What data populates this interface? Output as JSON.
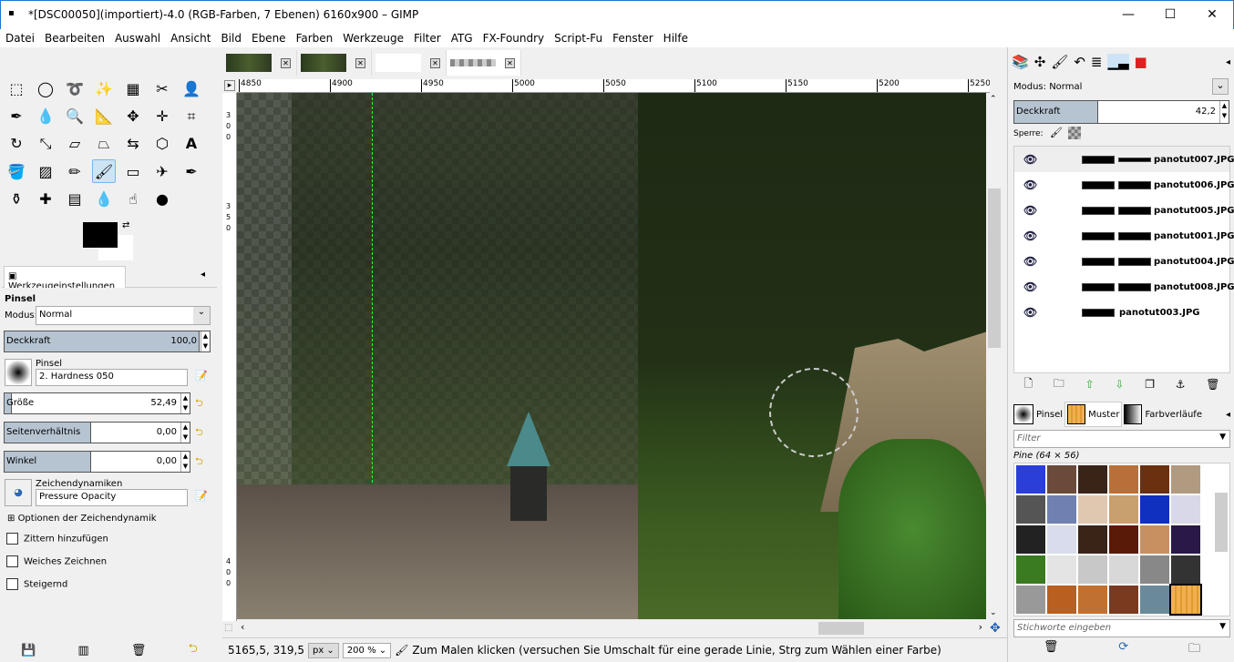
{
  "window": {
    "title": "*[DSC00050](importiert)-4.0 (RGB-Farben, 7 Ebenen) 6160x900 – GIMP",
    "minimize": "—",
    "maximize": "☐",
    "close": "✕"
  },
  "menu": [
    "Datei",
    "Bearbeiten",
    "Auswahl",
    "Ansicht",
    "Bild",
    "Ebene",
    "Farben",
    "Werkzeuge",
    "Filter",
    "ATG",
    "FX-Foundry",
    "Script-Fu",
    "Fenster",
    "Hilfe"
  ],
  "tool_options": {
    "tab": "Werkzeugeinstellungen",
    "tool": "Pinsel",
    "mode_label": "Modus:",
    "mode": "Normal",
    "opacity_label": "Deckkraft",
    "opacity": "100,0",
    "opacity_fraction": 1.0,
    "brush_label": "Pinsel",
    "brush": "2. Hardness 050",
    "size_label": "Größe",
    "size": "52,49",
    "aspect_label": "Seitenverhältnis",
    "aspect": "0,00",
    "angle_label": "Winkel",
    "angle": "0,00",
    "dynamics_label": "Zeichendynamiken",
    "dynamics": "Pressure Opacity",
    "dyn_options": "Optionen der Zeichendynamik",
    "jitter": "Zittern hinzufügen",
    "smooth": "Weiches Zeichnen",
    "incremental": "Steigernd"
  },
  "ruler": {
    "h": [
      "4850",
      "4900",
      "4950",
      "5000",
      "5050",
      "5100",
      "5150",
      "5200",
      "5250"
    ],
    "v": [
      "3",
      "0",
      "0",
      "3",
      "5",
      "0",
      "4",
      "0",
      "0"
    ]
  },
  "status": {
    "coords": "5165,5, 319,5",
    "unit": "px",
    "zoom": "200 %",
    "message": "Zum Malen klicken (versuchen Sie Umschalt für eine gerade Linie, Strg zum Wählen einer Farbe)"
  },
  "layers": {
    "mode_label": "Modus:",
    "mode": "Normal",
    "opacity_label": "Deckkraft",
    "opacity": "42,2",
    "opacity_fraction": 0.422,
    "lock_label": "Sperre:",
    "items": [
      {
        "name": "panotut007.JPG"
      },
      {
        "name": "panotut006.JPG"
      },
      {
        "name": "panotut005.JPG"
      },
      {
        "name": "panotut001.JPG"
      },
      {
        "name": "panotut004.JPG"
      },
      {
        "name": "panotut008.JPG"
      },
      {
        "name": "panotut003.JPG"
      }
    ]
  },
  "patterns": {
    "tabs": [
      "Pinsel",
      "Muster",
      "Farbverläufe"
    ],
    "filter_placeholder": "Filter",
    "selected": "Pine (64 × 56)",
    "tags_placeholder": "Stichworte eingeben",
    "colors": [
      "#2a3fd8",
      "#6b4a3a",
      "#3a2418",
      "#b8703a",
      "#6a3010",
      "#b09a80",
      "#555",
      "#7080b0",
      "#e0c8b0",
      "#c8a070",
      "#1030c0",
      "#d8d8e8",
      "#222",
      "#d8dcec",
      "#3a2418",
      "#5a1a08",
      "#c89060",
      "#2a1848",
      "#3a7a20",
      "#e4e4e4",
      "#c8c8c8",
      "#d8d8d8",
      "#888",
      "#333",
      "#999",
      "#b86020",
      "#c07030",
      "#7a3a20",
      "#6a8a9a",
      "#f0b050"
    ]
  }
}
